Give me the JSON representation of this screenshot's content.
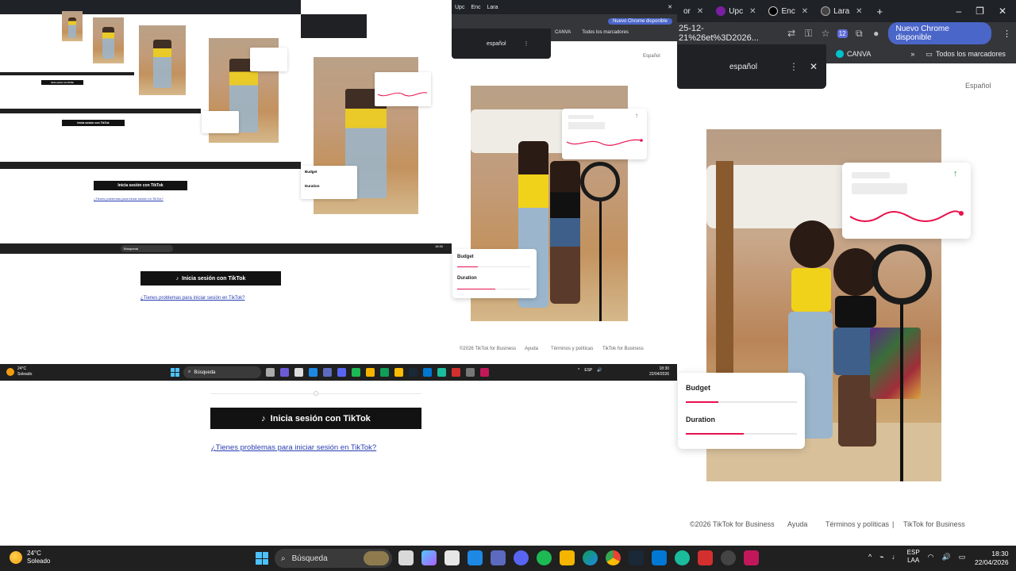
{
  "browser": {
    "tabs": [
      {
        "label": "or"
      },
      {
        "label": "Upc"
      },
      {
        "label": "Enc"
      },
      {
        "label": "Lara"
      }
    ],
    "new_tab": "+",
    "window_controls": [
      "–",
      "❐",
      "✕"
    ],
    "address_fragment": "25-12-21%26et%3D2026...",
    "extension_badge": "12",
    "update_button": "Nuevo Chrome disponible",
    "bookmarks": {
      "canva": "CANVA",
      "more": "»",
      "all": "Todos los marcadores"
    },
    "translate_popup": {
      "language": "español",
      "menu": "⋮",
      "close": "✕"
    }
  },
  "page": {
    "language_link": "Español",
    "stat_card": {
      "arrow": "↑"
    },
    "budget_card": {
      "budget_label": "Budget",
      "duration_label": "Duration",
      "budget_fill": 0.29,
      "duration_fill": 0.52
    },
    "login_button": "Inicia sesión con TikTok",
    "help_link": "¿Tienes problemas para iniciar sesión en TikTok?",
    "footer": {
      "copyright": "©2026 TikTok for Business",
      "help": "Ayuda",
      "terms": "Términos y políticas",
      "separator": "|",
      "business": "TikTok for Business"
    }
  },
  "nested_mid": {
    "language_link": "Español",
    "translate_language": "español",
    "update_button": "Nuevo Chrome disponible",
    "canva": "CANVA",
    "all_bookmarks": "Todos los marcadores",
    "budget_label": "Budget",
    "duration_label": "Duration",
    "footer": {
      "copyright": "©2026 TikTok for Business",
      "help": "Ayuda",
      "terms": "Términos y políticas",
      "business": "TikTok for Business"
    },
    "login_button": "Inicia sesión con TikTok",
    "help_link": "¿Tienes problemas para iniciar sesión en TikTok?",
    "taskbar": {
      "temp": "24°C",
      "weather": "Soleado",
      "search": "Búsqueda",
      "lang": "ESP",
      "region": "LAA",
      "time": "18:30",
      "date": "22/04/2026"
    }
  },
  "nested_small": {
    "login_button": "Inicia sesión con TikTok",
    "help_link": "¿Tienes problemas para iniciar sesión en TikTok?",
    "budget_label": "Budget",
    "duration_label": "Duration",
    "search": "Búsqueda"
  },
  "taskbar": {
    "temp": "24°C",
    "weather": "Soleado",
    "search": "Búsqueda",
    "lang": "ESP",
    "region": "LAA",
    "time": "18:30",
    "date": "22/04/2026",
    "apps": [
      "files",
      "copilot",
      "store",
      "mail",
      "teams",
      "discord",
      "spotify",
      "explorer",
      "edge",
      "chrome",
      "steam",
      "vscode",
      "acrobat",
      "obs",
      "calculator"
    ]
  },
  "colors": {
    "accent_pink": "#e8114e",
    "button_black": "#121212",
    "link_blue": "#2a3eb1",
    "chrome_dark": "#35363a",
    "taskbar": "#202020",
    "update_blue": "#4b66c9"
  }
}
